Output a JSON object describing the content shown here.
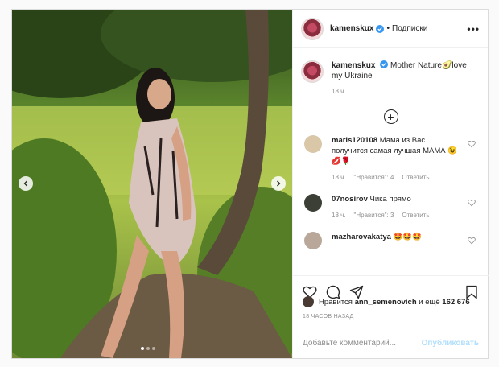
{
  "post": {
    "username": "kamenskux",
    "separator": "•",
    "follow_label": "Подписки",
    "more_label": "•••",
    "caption_text": "Mother Nature🥑love my Ukraine",
    "caption_time": "18 ч.",
    "plus_label": "+",
    "carousel": {
      "dots": 3,
      "active": 1
    }
  },
  "comments": [
    {
      "user": "maris120108",
      "text": "Мама из Вас получится самая лучшая МАМА 😉💋🌹",
      "time": "18 ч.",
      "likes": "\"Нравится\": 4",
      "reply": "Ответить",
      "avatar_color": "#d9c7a8"
    },
    {
      "user": "07nosirov",
      "text": "Чика прямо",
      "time": "18 ч.",
      "likes": "\"Нравится\": 3",
      "reply": "Ответить",
      "avatar_color": "#3b3f36"
    },
    {
      "user": "mazharovakatya",
      "text": "🤩🤩🤩",
      "time": "",
      "likes": "",
      "reply": "",
      "avatar_color": "#b9a89a"
    }
  ],
  "likes": {
    "prefix": "Нравится",
    "user": "ann_semenovich",
    "and_more": "и ещё",
    "count": "162 676"
  },
  "date_label": "18 ЧАСОВ НАЗАД",
  "add_comment": {
    "placeholder": "Добавьте комментарий...",
    "publish_label": "Опубликовать"
  },
  "colors": {
    "verified": "#3897f0",
    "publish_disabled": "#b2dffc",
    "border": "#dbdbdb"
  }
}
